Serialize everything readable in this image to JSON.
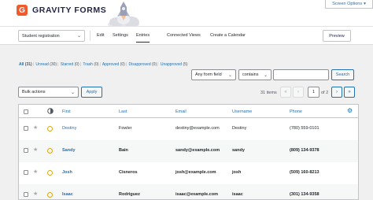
{
  "header": {
    "logo_mark": "G",
    "logo_text": "GRAVITY FORMS",
    "screen_options_label": "Screen Options",
    "screen_options_icon": "caret-down-icon"
  },
  "toolbar": {
    "form_selector_value": "Student registration",
    "tabs": [
      {
        "label": "Edit"
      },
      {
        "label": "Settings"
      },
      {
        "label": "Entries",
        "active": true
      },
      {
        "label": "Connected Views"
      },
      {
        "label": "Create a Calendar"
      }
    ],
    "preview_label": "Preview"
  },
  "filters": {
    "all": {
      "label": "All",
      "count": "(31)"
    },
    "unread": {
      "label": "Unread",
      "count": "(30)"
    },
    "starred": {
      "label": "Starred",
      "count": "(0)"
    },
    "trash": {
      "label": "Trash",
      "count": "(0)"
    },
    "approved": {
      "label": "Approved",
      "count": "(0)"
    },
    "disapproved": {
      "label": "Disapproved",
      "count": "(0)"
    },
    "unapproved": {
      "label": "Unapproved",
      "count": "(5)"
    }
  },
  "search": {
    "field_value": "Any form field",
    "operator_value": "contains",
    "query_value": "",
    "button_label": "Search"
  },
  "bulk": {
    "select_value": "Bulk actions",
    "apply_label": "Apply"
  },
  "pagination": {
    "items_count": "31 items",
    "first": "«",
    "prev": "‹",
    "current_page": "1",
    "of_total": "of 2",
    "next": "›",
    "last": "»"
  },
  "table": {
    "columns": {
      "first": "First",
      "last": "Last",
      "email": "Email",
      "username": "Username",
      "phone": "Phone"
    },
    "rows": [
      {
        "first": "Destiny",
        "last": "Fowler",
        "email": "destiny@example.com",
        "username": "Destiny",
        "phone": "(780) 559-0101",
        "unread": false
      },
      {
        "first": "Sandy",
        "last": "Bain",
        "email": "sandy@example.com",
        "username": "sandy",
        "phone": "(809) 134-9378",
        "unread": true
      },
      {
        "first": "Josh",
        "last": "Cisneros",
        "email": "josh@example.com",
        "username": "josh",
        "phone": "(509) 160-8213",
        "unread": true
      },
      {
        "first": "Isaac",
        "last": "Rodriguez",
        "email": "isaac@example.com",
        "username": "isaac",
        "phone": "(301) 134-9358",
        "unread": true
      }
    ]
  },
  "colors": {
    "accent": "#2271b1",
    "brand": "#f15a2b",
    "status_ring": "#dba617"
  }
}
